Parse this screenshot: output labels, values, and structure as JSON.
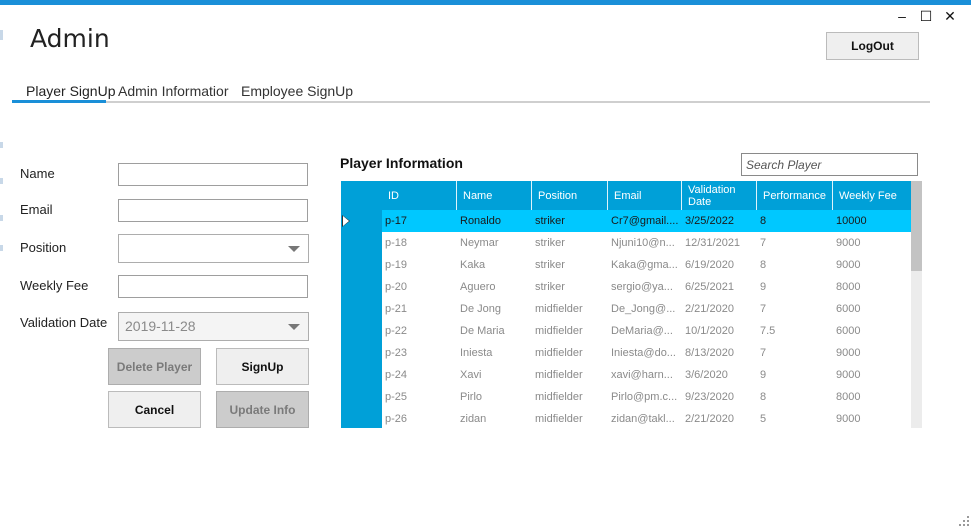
{
  "window": {
    "minimize_glyph": "–",
    "maximize_glyph": "☐",
    "close_glyph": "✕"
  },
  "app": {
    "title": "Admin"
  },
  "header": {
    "logout_label": "LogOut"
  },
  "tabs": [
    {
      "label": "Player SignUp",
      "active": true
    },
    {
      "label": "Admin Informatior",
      "active": false
    },
    {
      "label": "Employee SignUp",
      "active": false
    }
  ],
  "form": {
    "name_label": "Name",
    "name_value": "",
    "email_label": "Email",
    "email_value": "",
    "position_label": "Position",
    "position_value": "",
    "weekly_fee_label": "Weekly Fee",
    "weekly_fee_value": "",
    "validation_date_label": "Validation Date",
    "validation_date_value": "2019-11-28"
  },
  "actions": {
    "delete_label": "Delete Player",
    "signup_label": "SignUp",
    "cancel_label": "Cancel",
    "update_label": "Update Info"
  },
  "players": {
    "title": "Player Information",
    "search_placeholder": "Search Player",
    "columns": [
      "ID",
      "Name",
      "Position",
      "Email",
      "Validation Date",
      "Performance",
      "Weekly Fee"
    ],
    "rows": [
      [
        "p-17",
        "Ronaldo",
        "striker",
        "Cr7@gmail....",
        "3/25/2022",
        "8",
        "10000"
      ],
      [
        "p-18",
        "Neymar",
        "striker",
        "Njuni10@n...",
        "12/31/2021",
        "7",
        "9000"
      ],
      [
        "p-19",
        "Kaka",
        "striker",
        "Kaka@gma...",
        "6/19/2020",
        "8",
        "9000"
      ],
      [
        "p-20",
        "Aguero",
        "striker",
        "sergio@ya...",
        "6/25/2021",
        "9",
        "8000"
      ],
      [
        "p-21",
        "De Jong",
        "midfielder",
        "De_Jong@...",
        "2/21/2020",
        "7",
        "6000"
      ],
      [
        "p-22",
        "De Maria",
        "midfielder",
        "DeMaria@...",
        "10/1/2020",
        "7.5",
        "6000"
      ],
      [
        "p-23",
        "Iniesta",
        "midfielder",
        "Iniesta@do...",
        "8/13/2020",
        "7",
        "9000"
      ],
      [
        "p-24",
        "Xavi",
        "midfielder",
        "xavi@harn...",
        "3/6/2020",
        "9",
        "9000"
      ],
      [
        "p-25",
        "Pirlo",
        "midfielder",
        "Pirlo@pm.c...",
        "9/23/2020",
        "8",
        "8000"
      ],
      [
        "p-26",
        "zidan",
        "midfielder",
        "zidan@takl...",
        "2/21/2020",
        "5",
        "9000"
      ]
    ],
    "selected_row": 0
  },
  "colors": {
    "accent": "#1a8fd8",
    "grid_header": "#00a0d8",
    "selected_row": "#00c8ff"
  }
}
